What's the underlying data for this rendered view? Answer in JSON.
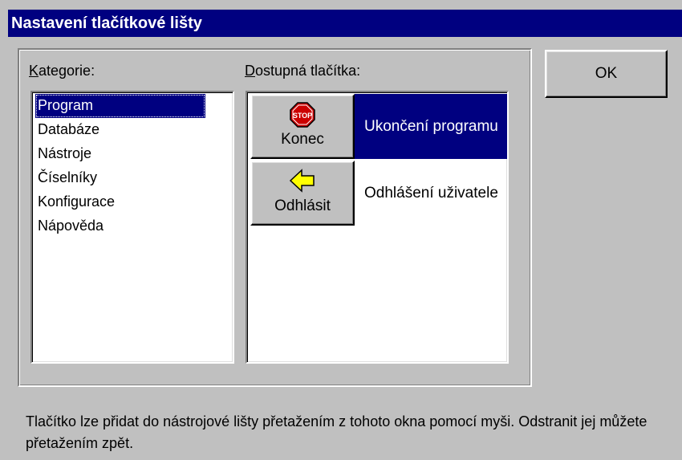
{
  "title": "Nastavení tlačítkové lišty",
  "categories_label_accesskey": "K",
  "categories_label_rest": "ategorie:",
  "categories": [
    "Program",
    "Databáze",
    "Nástroje",
    "Číselníky",
    "Konfigurace",
    "Nápověda"
  ],
  "selected_category": "Program",
  "buttons_label_accesskey": "D",
  "buttons_label_rest": "ostupná tlačítka:",
  "buttons": [
    {
      "icon": "stop-icon",
      "icon_text": "STOP",
      "caption": "Konec",
      "description": "Ukončení programu",
      "selected": true
    },
    {
      "icon": "arrow-left-icon",
      "caption": "Odhlásit",
      "description": "Odhlášení uživatele",
      "selected": false
    }
  ],
  "ok_label": "OK",
  "hint_text": "Tlačítko lze přidat do nástrojové lišty přetažením z tohoto okna pomocí myši. Odstranit jej můžete přetažením zpět.",
  "colors": {
    "titlebar": "#000080",
    "selection": "#000080",
    "face": "#c0c0c0",
    "stop_red": "#cc0000",
    "arrow_yellow": "#ffff00"
  }
}
